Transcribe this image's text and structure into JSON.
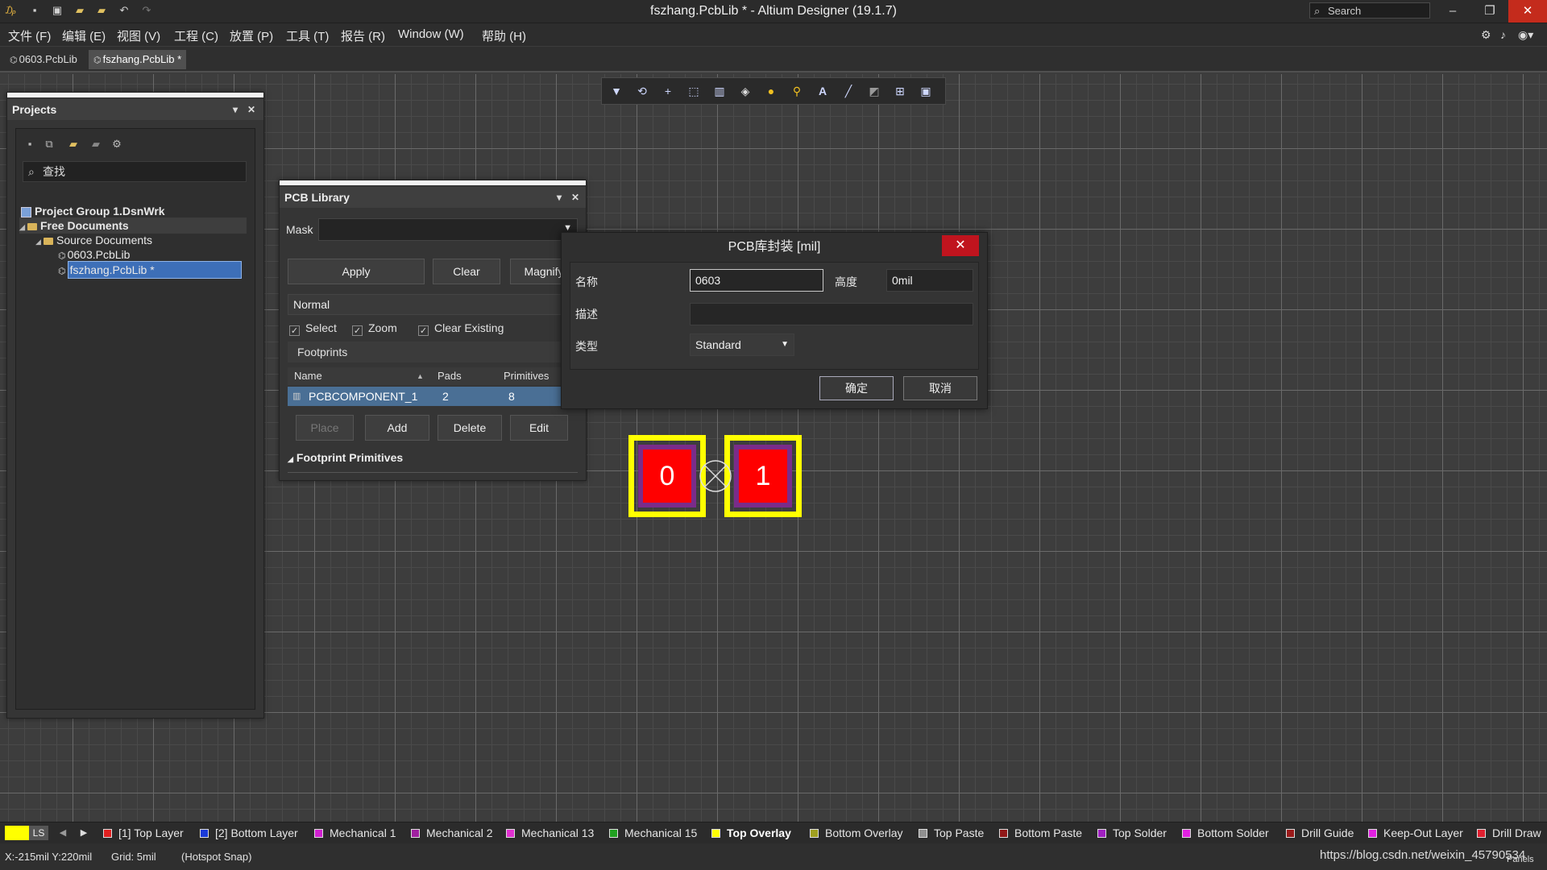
{
  "window": {
    "title": "fszhang.PcbLib * - Altium Designer (19.1.7)",
    "search_placeholder": "Search",
    "quick_access": [
      "app-icon",
      "save-icon",
      "save-all-icon",
      "open-icon",
      "open-project-icon",
      "undo-icon",
      "redo-icon"
    ]
  },
  "menu": {
    "items": [
      "文件 (F)",
      "编辑 (E)",
      "视图 (V)",
      "工程 (C)",
      "放置 (P)",
      "工具 (T)",
      "报告 (R)",
      "Window (W)",
      "帮助 (H)"
    ],
    "right_icons": [
      "gear-icon",
      "bell-icon",
      "user-icon"
    ]
  },
  "doc_tabs": [
    {
      "label": "0603.PcbLib",
      "active": false
    },
    {
      "label": "fszhang.PcbLib *",
      "active": true
    }
  ],
  "placement_toolbar": [
    "filter-icon",
    "route-icon",
    "cross-icon",
    "select-rect-icon",
    "align-icon",
    "place-component-icon",
    "pad-icon",
    "via-icon",
    "text-icon",
    "line-icon",
    "fill-icon",
    "dimension-icon",
    "region-icon"
  ],
  "projects": {
    "title": "Projects",
    "search_placeholder": "查找",
    "tree": [
      {
        "label": "Project Group 1.DsnWrk",
        "level": 0,
        "type": "group",
        "bold": true
      },
      {
        "label": "Free Documents",
        "level": 1,
        "type": "folder",
        "bold": true
      },
      {
        "label": "Source Documents",
        "level": 2,
        "type": "folder",
        "bold": false
      },
      {
        "label": "0603.PcbLib",
        "level": 3,
        "type": "doc",
        "bold": false
      },
      {
        "label": "fszhang.PcbLib *",
        "level": 3,
        "type": "doc",
        "bold": false,
        "selected": true
      }
    ]
  },
  "pcb_library": {
    "title": "PCB Library",
    "mask_label": "Mask",
    "mask_value": "",
    "apply_label": "Apply",
    "clear_label": "Clear",
    "magnify_label": "Magnify",
    "mode_value": "Normal",
    "checkboxes": [
      {
        "label": "Select",
        "checked": true
      },
      {
        "label": "Zoom",
        "checked": true
      },
      {
        "label": "Clear Existing",
        "checked": true
      }
    ],
    "footprints_label": "Footprints",
    "columns": [
      "Name",
      "Pads",
      "Primitives"
    ],
    "rows": [
      {
        "name": "PCBCOMPONENT_1",
        "pads": "2",
        "primitives": "8"
      }
    ],
    "place_label": "Place",
    "add_label": "Add",
    "delete_label": "Delete",
    "edit_label": "Edit",
    "primitives_section": "Footprint Primitives"
  },
  "dialog": {
    "title": "PCB库封装 [mil]",
    "name_label": "名称",
    "name_value": "0603",
    "height_label": "高度",
    "height_value": "0mil",
    "desc_label": "描述",
    "desc_value": "",
    "type_label": "类型",
    "type_value": "Standard",
    "ok_label": "确定",
    "cancel_label": "取消"
  },
  "footprint": {
    "pad_labels": [
      "0",
      "1"
    ],
    "colors": {
      "overlay": "#ffff00",
      "pad": "#ff0000",
      "solder": "#7a2c8a"
    }
  },
  "layers": {
    "ls_label": "LS",
    "tabs": [
      {
        "label": "[1] Top Layer",
        "color": "#e02020"
      },
      {
        "label": "[2] Bottom Layer",
        "color": "#1a3ad8"
      },
      {
        "label": "Mechanical 1",
        "color": "#d020d0"
      },
      {
        "label": "Mechanical 2",
        "color": "#a020a0"
      },
      {
        "label": "Mechanical 13",
        "color": "#e030d0"
      },
      {
        "label": "Mechanical 15",
        "color": "#20a020"
      },
      {
        "label": "Top Overlay",
        "color": "#ffff00",
        "active": true
      },
      {
        "label": "Bottom Overlay",
        "color": "#a0a020"
      },
      {
        "label": "Top Paste",
        "color": "#909090"
      },
      {
        "label": "Bottom Paste",
        "color": "#901818"
      },
      {
        "label": "Top Solder",
        "color": "#a020c0"
      },
      {
        "label": "Bottom Solder",
        "color": "#e020e0"
      },
      {
        "label": "Drill Guide",
        "color": "#9a1a1a"
      },
      {
        "label": "Keep-Out Layer",
        "color": "#e020e0"
      },
      {
        "label": "Drill Draw",
        "color": "#e02030"
      }
    ]
  },
  "status": {
    "coords": "X:-215mil Y:220mil",
    "grid": "Grid: 5mil",
    "snap": "(Hotspot Snap)",
    "watermark": "https://blog.csdn.net/weixin_45790534",
    "panels_label": "Panels"
  }
}
